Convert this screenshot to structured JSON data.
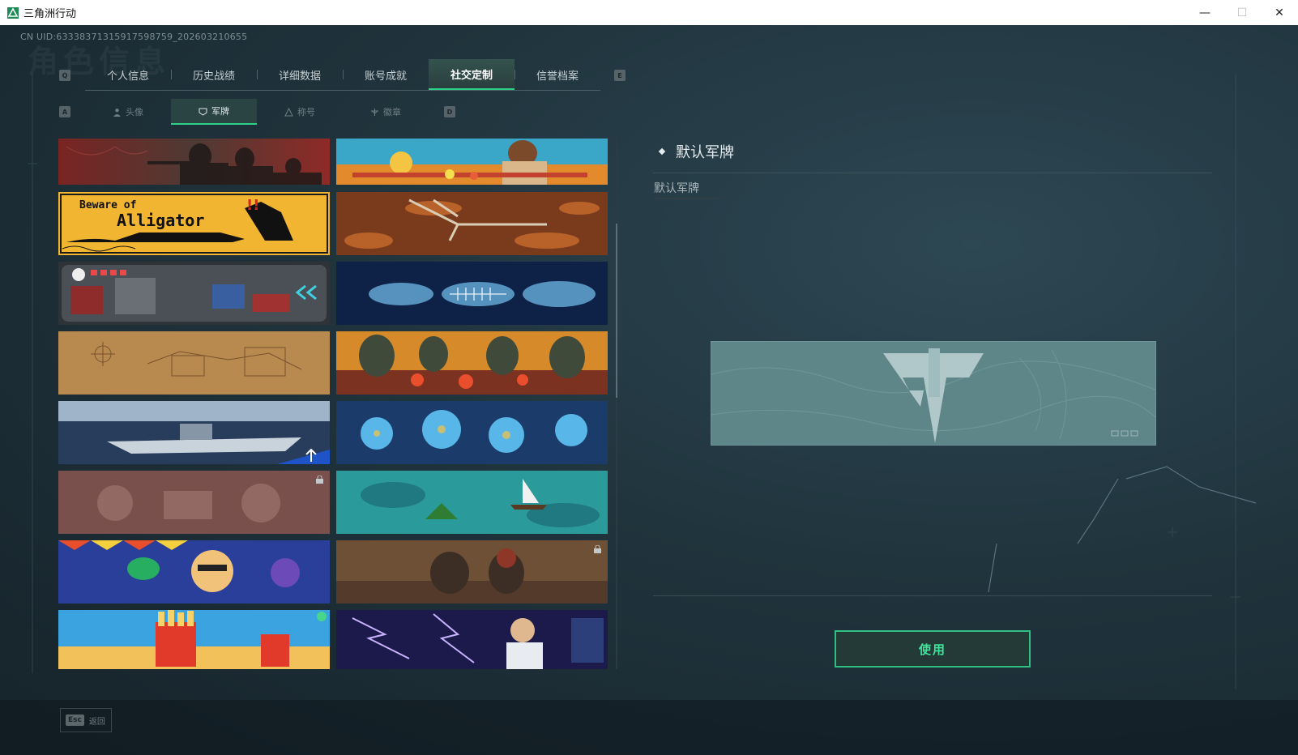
{
  "window": {
    "title": "三角洲行动",
    "minimize": "—",
    "maximize": "☐",
    "close": "✕"
  },
  "header": {
    "uid": "CN UID:633383713159175987​59_202603210655",
    "bg_title": "角色信息"
  },
  "tabs": {
    "prev_key": "Q",
    "next_key": "E",
    "items": [
      {
        "label": "个人信息"
      },
      {
        "label": "历史战绩"
      },
      {
        "label": "详细数据"
      },
      {
        "label": "账号成就"
      },
      {
        "label": "社交定制"
      },
      {
        "label": "信誉档案"
      }
    ],
    "active_index": 4
  },
  "subtabs": {
    "prev_key": "A",
    "next_key": "D",
    "items": [
      {
        "label": "头像",
        "icon": "person-icon"
      },
      {
        "label": "军牌",
        "icon": "badge-icon"
      },
      {
        "label": "称号",
        "icon": "triangle-icon"
      },
      {
        "label": "徽章",
        "icon": "emblem-icon"
      }
    ],
    "active_index": 1
  },
  "cards": [
    {
      "theme": "soldiers-red",
      "alligator_line1": "",
      "alligator_line2": ""
    },
    {
      "theme": "festival-food"
    },
    {
      "theme": "beware-alligator",
      "line1": "Beware of",
      "line2": "Alligator"
    },
    {
      "theme": "skeleton-leaves"
    },
    {
      "theme": "pixel-game"
    },
    {
      "theme": "xray-bodies"
    },
    {
      "theme": "sketch-map"
    },
    {
      "theme": "feast-table"
    },
    {
      "theme": "aircraft-carrier"
    },
    {
      "theme": "blue-flowers"
    },
    {
      "theme": "cake-locked",
      "locked": true
    },
    {
      "theme": "sea-boats"
    },
    {
      "theme": "party-cartoon"
    },
    {
      "theme": "desert-locked",
      "locked": true
    },
    {
      "theme": "fries-cartoon"
    },
    {
      "theme": "lightning-scientist"
    }
  ],
  "detail": {
    "title": "默认军牌",
    "subtitle": "默认军牌",
    "use_button": "使用"
  },
  "footer": {
    "esc_key": "Esc",
    "esc_label": "返回"
  },
  "colors": {
    "accent": "#2fd08a",
    "preview_bg": "#5e8689"
  }
}
